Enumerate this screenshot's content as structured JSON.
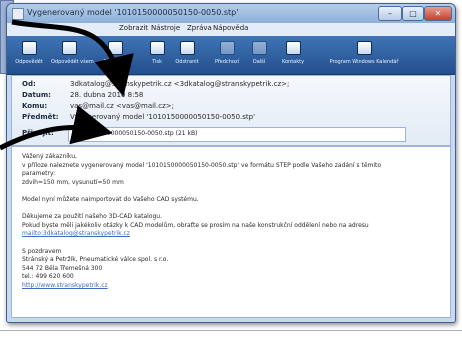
{
  "window": {
    "title": "Vygenerovaný model '10101500000501​50-0050.stp'"
  },
  "controls": {
    "minimize": "–",
    "maximize": "□",
    "close": "✕"
  },
  "menu": [
    "Zobrazit",
    "Nástroje",
    "Zpráva",
    "Nápověda"
  ],
  "toolbar": [
    {
      "label": "Odpovědět",
      "icon": "reply-icon",
      "enabled": true
    },
    {
      "label": "Odpovědět všem",
      "icon": "reply-all-icon",
      "enabled": true
    },
    {
      "label": "Přeposlat",
      "icon": "forward-icon",
      "enabled": true
    },
    {
      "label": "Tisk",
      "icon": "print-icon",
      "enabled": true
    },
    {
      "label": "Odstranit",
      "icon": "delete-icon",
      "enabled": true
    },
    {
      "label": "Předchozí",
      "icon": "previous-icon",
      "enabled": false
    },
    {
      "label": "Další",
      "icon": "next-icon",
      "enabled": false
    },
    {
      "label": "Kontakty",
      "icon": "contacts-icon",
      "enabled": true
    },
    {
      "label": "Program Windows Kalendář",
      "icon": "calendar-icon",
      "enabled": true
    }
  ],
  "headers": {
    "from_label": "Od:",
    "from_value": "3dkatalog@stranskypetrik.cz <3dkatalog@stranskypetrik.cz>;",
    "date_label": "Datum:",
    "date_value": "28. dubna 2010 8:58",
    "to_label": "Komu:",
    "to_value": "vas@mail.cz <vas@mail.cz>;",
    "subject_label": "Předmět:",
    "subject_value": "Vygenerovaný model '10101500000501​50-0050.stp'",
    "attach_label": "Připojit:",
    "attachment": "10101500000501​50-0050.stp (21 kB)"
  },
  "body": [
    {
      "text": "Vážený zákazníku,",
      "link": false
    },
    {
      "text": "v příloze naleznete vygenerovaný model '1010150000050150-0050.stp' ve formátu STEP podle Vašeho zadání s těmito",
      "link": false
    },
    {
      "text": "parametry:",
      "link": false
    },
    {
      "text": "zdvih=150 mm, vysunutí=50 mm",
      "link": false
    },
    {
      "text": "",
      "link": false
    },
    {
      "text": "Model nyní můžete naimportovat do Vašeho CAD systému.",
      "link": false
    },
    {
      "text": "",
      "link": false
    },
    {
      "text": "Děkujeme za použití našeho 3D-CAD katalogu.",
      "link": false
    },
    {
      "text": "Pokud byste měli jakékoliv otázky k CAD modelům, obraťte se prosím na naše konstrukční oddělení nebo na adresu",
      "link": false
    },
    {
      "text": "mailto:3dkatalog@stranskypetrik.cz",
      "link": true
    },
    {
      "text": "",
      "link": false
    },
    {
      "text": "S pozdravem",
      "link": false
    },
    {
      "text": "Stránský a Petržík, Pneumatické válce spol. s r.o.",
      "link": false
    },
    {
      "text": "544 72 Běla Třemešná 300",
      "link": false
    },
    {
      "text": "tel.: 499 620 600",
      "link": false
    },
    {
      "text": "http://www.stranskypetrik.cz",
      "link": true
    }
  ]
}
